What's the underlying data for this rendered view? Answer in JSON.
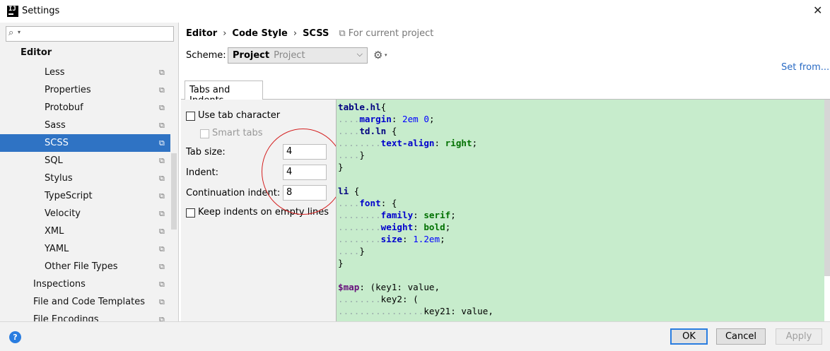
{
  "window": {
    "title": "Settings",
    "app_icon": "intellij-icon",
    "close": "✕"
  },
  "sidebar": {
    "search_placeholder": "",
    "items": [
      {
        "label": "Editor",
        "bold": true,
        "copy_icon": false
      },
      {
        "label": "Less",
        "copy_icon": true
      },
      {
        "label": "Properties",
        "copy_icon": true
      },
      {
        "label": "Protobuf",
        "copy_icon": true
      },
      {
        "label": "Sass",
        "copy_icon": true
      },
      {
        "label": "SCSS",
        "copy_icon": true,
        "selected": true
      },
      {
        "label": "SQL",
        "copy_icon": true
      },
      {
        "label": "Stylus",
        "copy_icon": true
      },
      {
        "label": "TypeScript",
        "copy_icon": true
      },
      {
        "label": "Velocity",
        "copy_icon": true
      },
      {
        "label": "XML",
        "copy_icon": true
      },
      {
        "label": "YAML",
        "copy_icon": true
      },
      {
        "label": "Other File Types",
        "copy_icon": true
      },
      {
        "label": "Inspections",
        "copy_icon": true
      },
      {
        "label": "File and Code Templates",
        "copy_icon": true
      },
      {
        "label": "File Encodings",
        "copy_icon": true
      }
    ]
  },
  "breadcrumb": {
    "items": [
      "Editor",
      "Code Style",
      "SCSS"
    ],
    "separator": "›",
    "scope": "For current project"
  },
  "scheme": {
    "label": "Scheme:",
    "value": "Project",
    "sub": "Project",
    "set_from": "Set from..."
  },
  "tabs": [
    {
      "label": "Tabs and Indents"
    }
  ],
  "form": {
    "use_tab_character": {
      "label": "Use tab character",
      "checked": false
    },
    "smart_tabs": {
      "label": "Smart tabs",
      "checked": false,
      "disabled": true
    },
    "tab_size": {
      "label": "Tab size:",
      "value": "4"
    },
    "indent": {
      "label": "Indent:",
      "value": "4"
    },
    "continuation_indent": {
      "label": "Continuation indent:",
      "value": "8"
    },
    "keep_indents": {
      "label": "Keep indents on empty lines",
      "checked": false
    }
  },
  "code_preview": [
    [
      [
        "sel-c",
        "table.hl"
      ],
      [
        "",
        "{"
      ]
    ],
    [
      [
        "ind",
        "...."
      ],
      [
        "prop",
        "margin"
      ],
      [
        "",
        ": "
      ],
      [
        "num",
        "2em 0"
      ],
      [
        "",
        ";"
      ]
    ],
    [
      [
        "ind",
        "...."
      ],
      [
        "sel-c",
        "td.ln"
      ],
      [
        "",
        " {"
      ]
    ],
    [
      [
        "ind",
        "........"
      ],
      [
        "prop",
        "text-align"
      ],
      [
        "",
        ": "
      ],
      [
        "val",
        "right"
      ],
      [
        "",
        ";"
      ]
    ],
    [
      [
        "ind",
        "...."
      ],
      [
        "",
        "}"
      ]
    ],
    [
      [
        "",
        "}"
      ]
    ],
    [],
    [
      [
        "sel-c",
        "li"
      ],
      [
        "",
        " {"
      ]
    ],
    [
      [
        "ind",
        "...."
      ],
      [
        "prop",
        "font"
      ],
      [
        "",
        ": {"
      ]
    ],
    [
      [
        "ind",
        "........"
      ],
      [
        "prop",
        "family"
      ],
      [
        "",
        ": "
      ],
      [
        "val",
        "serif"
      ],
      [
        "",
        ";"
      ]
    ],
    [
      [
        "ind",
        "........"
      ],
      [
        "prop",
        "weight"
      ],
      [
        "",
        ": "
      ],
      [
        "val",
        "bold"
      ],
      [
        "",
        ";"
      ]
    ],
    [
      [
        "ind",
        "........"
      ],
      [
        "prop",
        "size"
      ],
      [
        "",
        ": "
      ],
      [
        "num",
        "1.2em"
      ],
      [
        "",
        ";"
      ]
    ],
    [
      [
        "ind",
        "...."
      ],
      [
        "",
        "}"
      ]
    ],
    [
      [
        "",
        "}"
      ]
    ],
    [],
    [
      [
        "var",
        "$map"
      ],
      [
        "",
        ": ("
      ],
      [
        "",
        "key1: value,"
      ]
    ],
    [
      [
        "ind",
        "........"
      ],
      [
        "",
        "key2: ("
      ]
    ],
    [
      [
        "ind",
        "................"
      ],
      [
        "",
        "key21: value,"
      ]
    ]
  ],
  "buttons": {
    "ok": "OK",
    "cancel": "Cancel",
    "apply": "Apply",
    "help": "?"
  },
  "colors": {
    "selection": "#2f73c4",
    "code_bg": "#c7eccc",
    "link": "#2a6bc4",
    "annotation_circle": "#d42020"
  }
}
